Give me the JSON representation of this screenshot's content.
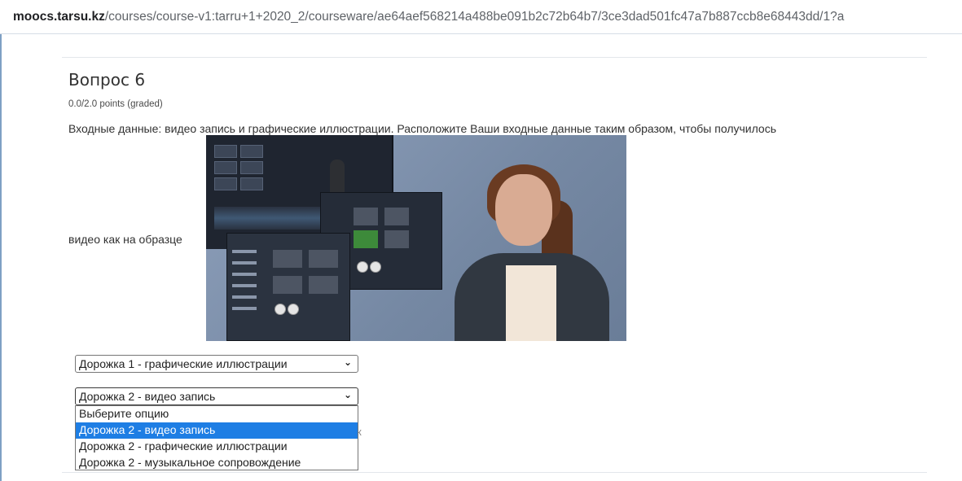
{
  "browser": {
    "url_host": "moocs.tarsu.kz",
    "url_path": "/courses/course-v1:tarru+1+2020_2/courseware/ae64aef568214a488be091b2c72b64b7/3ce3dad501fc47a7b887ccb8e68443dd/1?a"
  },
  "question": {
    "title": "Вопрос 6",
    "points": "0.0/2.0 points (graded)",
    "text": "Входные данные: видео запись и графические иллюстрации. Расположите Ваши входные данные таким образом, чтобы получилось",
    "sample_label": "видео как на образце"
  },
  "track1_select": {
    "value": "Дорожка 1 - графические иллюстрации"
  },
  "track2_select": {
    "value": "Дорожка 2 - видео запись",
    "options": [
      "Выберите опцию",
      "Дорожка 2 - видео запись",
      "Дорожка 2 - графические иллюстрации",
      "Дорожка 2 - музыкальное сопровождение"
    ],
    "highlighted_index": 1
  },
  "partial_text": "к",
  "colors": {
    "highlight": "#1e7ee4",
    "text": "#313131",
    "border": "#7ea0c4"
  }
}
